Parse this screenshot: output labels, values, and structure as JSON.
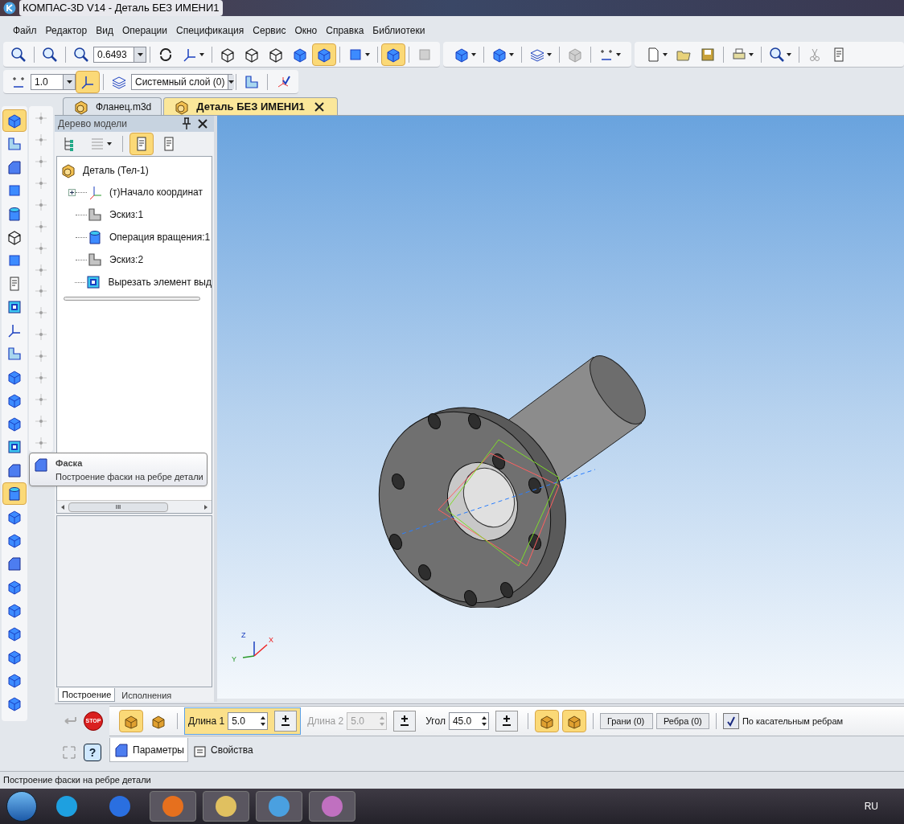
{
  "window": {
    "title": "КОМПАС-3D V14 - Деталь БЕЗ ИМЕНИ1"
  },
  "menu": [
    "Файл",
    "Редактор",
    "Вид",
    "Операции",
    "Спецификация",
    "Сервис",
    "Окно",
    "Справка",
    "Библиотеки"
  ],
  "toolbar_view": {
    "zoom_value": "0.6493",
    "display_modes": [
      {
        "selected": false
      },
      {
        "selected": false
      },
      {
        "selected": false
      },
      {
        "selected": false
      },
      {
        "selected": true
      }
    ],
    "orientation_toggle": {
      "on": true
    }
  },
  "toolbar_current": {
    "step_value": "1.0",
    "snap_toggle": {
      "on": true
    },
    "layer": "Системный слой (0)"
  },
  "document_tabs": [
    {
      "label": "Фланец.m3d",
      "selected": false
    },
    {
      "label": "Деталь БЕЗ ИМЕНИ1",
      "selected": true
    }
  ],
  "model_tree": {
    "title": "Дерево модели",
    "list_mode": {
      "on": true
    },
    "root": {
      "label": "Деталь (Тел-1)",
      "children": [
        {
          "label": "(т)Начало координат",
          "kind": "origin"
        },
        {
          "label": "Эскиз:1",
          "kind": "sketch"
        },
        {
          "label": "Операция вращения:1",
          "kind": "revolve"
        },
        {
          "label": "Эскиз:2",
          "kind": "sketch"
        },
        {
          "label": "Вырезать элемент выд",
          "kind": "cut"
        }
      ]
    },
    "bottom_tabs": [
      {
        "label": "Построение",
        "selected": true
      },
      {
        "label": "Исполнения",
        "selected": false
      }
    ],
    "scroll_mark": "III"
  },
  "axes": {
    "z": "Z",
    "x": "X",
    "y": "Y"
  },
  "tooltip": {
    "title": "Фаска",
    "text": "Построение фаски на ребре детали"
  },
  "properties": {
    "direction_buttons": [
      {
        "selected": true
      },
      {
        "selected": false
      }
    ],
    "fields": [
      {
        "label": "Длина 1",
        "value": "5.0",
        "disabled": false,
        "highlighted": true
      },
      {
        "label": "Длина 2",
        "value": "5.0",
        "disabled": true,
        "highlighted": false
      },
      {
        "label": "Угол",
        "value": "45.0",
        "disabled": false,
        "highlighted": false
      }
    ],
    "mode_buttons": [
      {
        "selected": true
      },
      {
        "selected": true
      }
    ],
    "counters": [
      "Грани (0)",
      "Ребра (0)"
    ],
    "tangent": {
      "label": "По касательным ребрам",
      "checked": true
    },
    "stop": "STOP",
    "help": "?",
    "tabs": [
      {
        "label": "Параметры",
        "selected": true
      },
      {
        "label": "Свойства",
        "selected": false
      }
    ]
  },
  "status_bar": "Построение фаски на ребре детали",
  "taskbar": {
    "language": "RU"
  }
}
